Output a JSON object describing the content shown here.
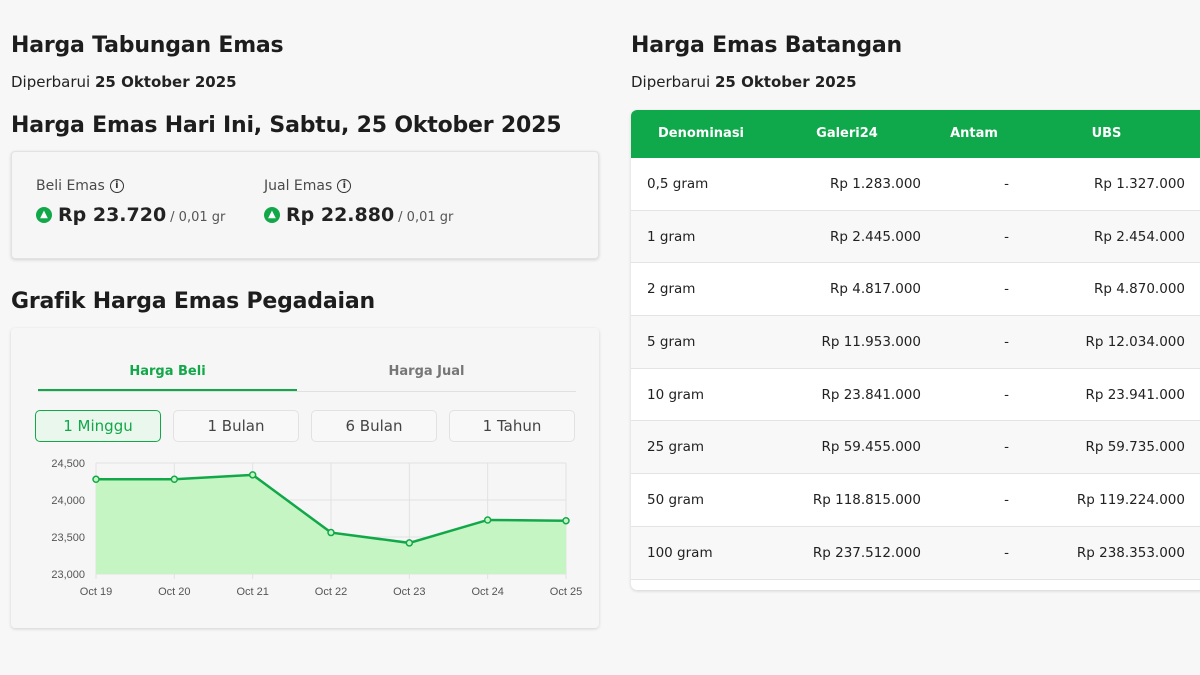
{
  "left": {
    "title": "Harga Tabungan Emas",
    "updated_prefix": "Diperbarui",
    "updated_date": "25 Oktober 2025",
    "today_title": "Harga Emas Hari Ini, Sabtu, 25 Oktober 2025",
    "beli": {
      "label": "Beli Emas",
      "price": "Rp 23.720",
      "unit": "/ 0,01 gr"
    },
    "jual": {
      "label": "Jual Emas",
      "price": "Rp 22.880",
      "unit": "/ 0,01 gr"
    },
    "grafik_title": "Grafik Harga Emas Pegadaian",
    "tabs": [
      "Harga Beli",
      "Harga Jual"
    ],
    "ranges": [
      "1 Minggu",
      "1 Bulan",
      "6 Bulan",
      "1 Tahun"
    ]
  },
  "right": {
    "title": "Harga Emas Batangan",
    "updated_prefix": "Diperbarui",
    "updated_date": "25 Oktober 2025",
    "headers": [
      "Denominasi",
      "Galeri24",
      "Antam",
      "UBS"
    ],
    "rows": [
      [
        "0,5 gram",
        "Rp 1.283.000",
        "-",
        "Rp 1.327.000"
      ],
      [
        "1 gram",
        "Rp 2.445.000",
        "-",
        "Rp 2.454.000"
      ],
      [
        "2 gram",
        "Rp 4.817.000",
        "-",
        "Rp 4.870.000"
      ],
      [
        "5 gram",
        "Rp 11.953.000",
        "-",
        "Rp 12.034.000"
      ],
      [
        "10 gram",
        "Rp 23.841.000",
        "-",
        "Rp 23.941.000"
      ],
      [
        "25 gram",
        "Rp 59.455.000",
        "-",
        "Rp 59.735.000"
      ],
      [
        "50 gram",
        "Rp 118.815.000",
        "-",
        "Rp 119.224.000"
      ],
      [
        "100 gram",
        "Rp 237.512.000",
        "-",
        "Rp 238.353.000"
      ]
    ]
  },
  "colors": {
    "accent": "#12a84a",
    "fill": "#c6f5c4"
  },
  "chart_data": {
    "type": "area",
    "categories": [
      "Oct 19",
      "Oct 20",
      "Oct 21",
      "Oct 22",
      "Oct 23",
      "Oct 24",
      "Oct 25"
    ],
    "values": [
      24280,
      24280,
      24340,
      23560,
      23420,
      23730,
      23720
    ],
    "ylim": [
      23000,
      24500
    ],
    "yticks": [
      23000,
      23500,
      24000,
      24500
    ],
    "ytick_labels": [
      "23,000",
      "23,500",
      "24,000",
      "24,500"
    ],
    "grid": true
  }
}
